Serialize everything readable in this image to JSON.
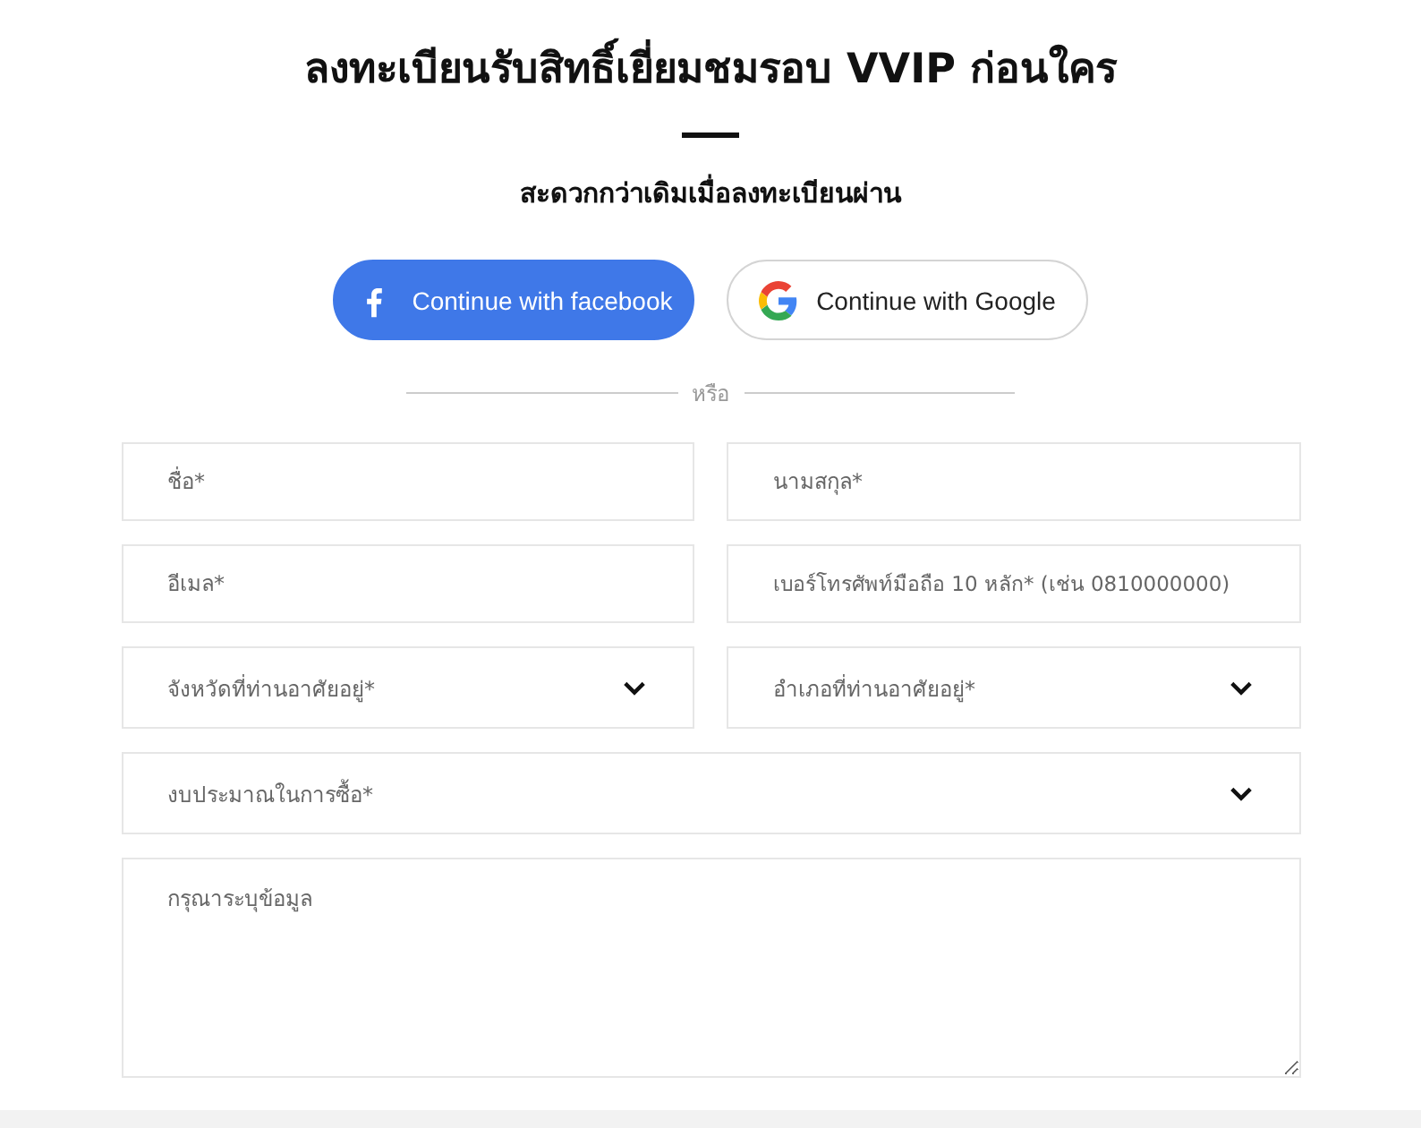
{
  "title": "ลงทะเบียนรับสิทธิ์เยี่ยมชมรอบ VVIP ก่อนใคร",
  "subtitle": "สะดวกกว่าเดิมเมื่อลงทะเบียนผ่าน",
  "social_buttons": [
    {
      "kind": "facebook",
      "label": "Continue with facebook"
    },
    {
      "kind": "google",
      "label": "Continue with Google"
    }
  ],
  "divider": "หรือ",
  "fields": [
    {
      "kind": "input",
      "placeholder": "ชื่อ*"
    },
    {
      "kind": "input",
      "placeholder": "นามสกุล*"
    },
    {
      "kind": "input",
      "placeholder": "อีเมล*"
    },
    {
      "kind": "input",
      "placeholder": "เบอร์โทรศัพท์มือถือ 10 หลัก* (เช่น 0810000000)"
    },
    {
      "kind": "select",
      "placeholder": "จังหวัดที่ท่านอาศัยอยู่*"
    },
    {
      "kind": "select",
      "placeholder": "อำเภอที่ท่านอาศัยอยู่*"
    },
    {
      "kind": "select-wide",
      "placeholder": "งบประมาณในการซื้อ*"
    },
    {
      "kind": "textarea",
      "placeholder": "กรุณาระบุข้อมูล"
    }
  ]
}
